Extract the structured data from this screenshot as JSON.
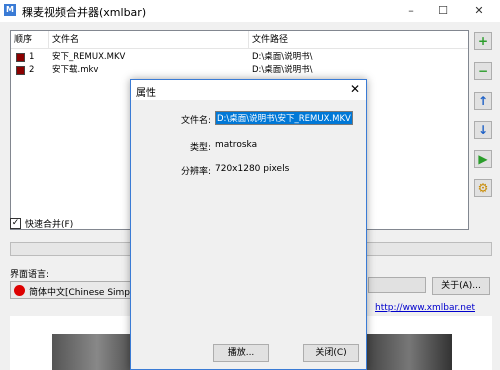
{
  "window": {
    "icon_text": "M",
    "title": "稞麦视频合并器(xmlbar)",
    "min": "–",
    "max": "☐",
    "close": "✕"
  },
  "list": {
    "headers": [
      "顺序",
      "文件名",
      "文件路径"
    ],
    "rows": [
      {
        "index": "1",
        "filename": "安下_REMUX.MKV",
        "path": "D:\\桌面\\说明书\\"
      },
      {
        "index": "2",
        "filename": "安下载.mkv",
        "path": "D:\\桌面\\说明书\\"
      }
    ]
  },
  "side_buttons": {
    "add": "+",
    "remove": "−",
    "up": "↑",
    "down": "↓",
    "play": "▶",
    "settings": "⚙"
  },
  "colors": {
    "add": "#2a9d2a",
    "remove": "#2a9d2a",
    "up": "#1f62c7",
    "down": "#1f62c7",
    "play": "#2a9d2a",
    "settings": "#c98a00"
  },
  "fast_merge": {
    "checked": "✓",
    "label": "快速合并(F)"
  },
  "language": {
    "label": "界面语言:",
    "selected": "简体中文[Chinese Simplified]"
  },
  "about": {
    "label": "关于(A)..."
  },
  "url": "http://www.xmlbar.net",
  "dialog": {
    "title": "属性",
    "close": "✕",
    "filename_label": "文件名:",
    "filename_value": "D:\\桌面\\说明书\\安下_REMUX.MKV",
    "type_label": "类型:",
    "type_value": "matroska",
    "resolution_label": "分辨率:",
    "resolution_value": "720x1280 pixels",
    "play_label": "播放...",
    "close_label": "关闭(C)"
  }
}
